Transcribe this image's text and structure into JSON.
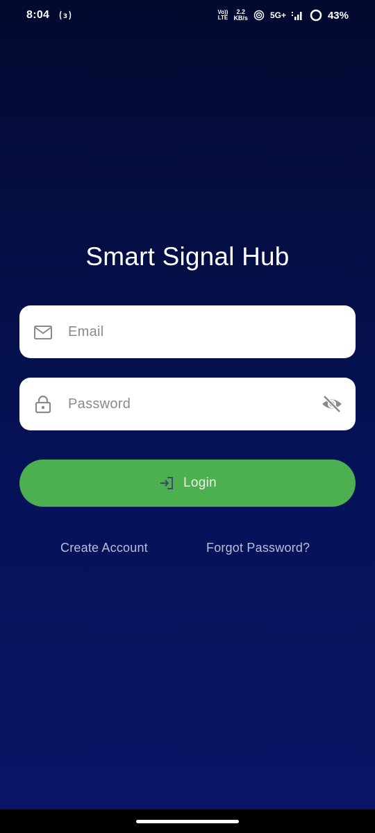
{
  "status_bar": {
    "time": "8:04",
    "volte_top": "Vo))",
    "volte_bottom": "LTE",
    "speed_value": "2.2",
    "speed_unit": "KB/s",
    "network": "5G+",
    "battery": "43%",
    "icons": [
      "hotspot-icon",
      "wifi-calling-icon",
      "signal-icon",
      "battery-icon"
    ]
  },
  "app": {
    "title": "Smart Signal Hub"
  },
  "form": {
    "email_placeholder": "Email",
    "email_icon": "mail-icon",
    "password_placeholder": "Password",
    "password_icon": "lock-icon",
    "visibility_icon": "eye-off-icon",
    "login_label": "Login",
    "login_icon": "login-icon"
  },
  "links": {
    "create_account": "Create Account",
    "forgot_password": "Forgot Password?"
  },
  "colors": {
    "background_top": "#020a2f",
    "background_bottom": "#081566",
    "button": "#4caf50",
    "input_bg": "#ffffff",
    "link_text": "#b9bfdc"
  }
}
